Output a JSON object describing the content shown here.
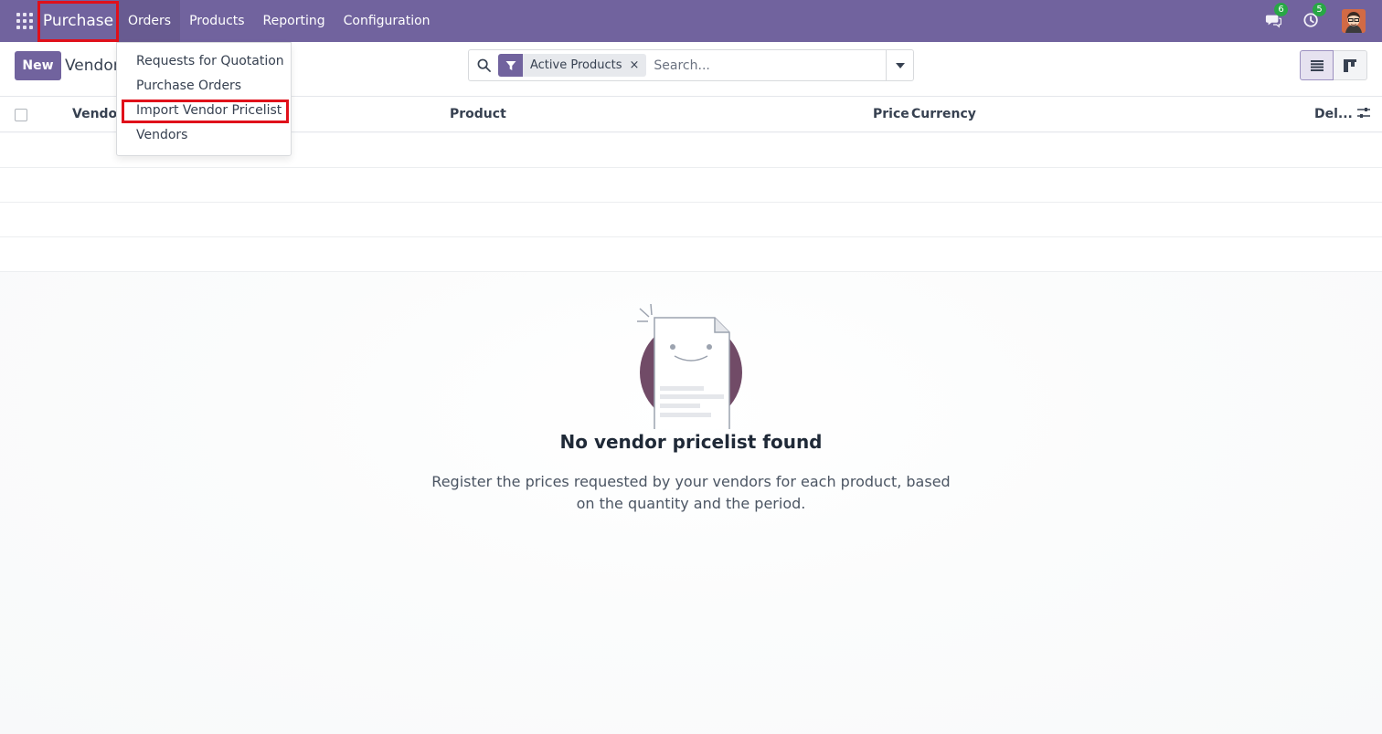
{
  "navbar": {
    "brand": "Purchase",
    "menu": [
      {
        "label": "Orders",
        "active": true
      },
      {
        "label": "Products",
        "active": false
      },
      {
        "label": "Reporting",
        "active": false
      },
      {
        "label": "Configuration",
        "active": false
      }
    ],
    "messages_badge": "6",
    "activities_badge": "5"
  },
  "dropdown": {
    "items": [
      "Requests for Quotation",
      "Purchase Orders",
      "Import Vendor Pricelist",
      "Vendors"
    ],
    "highlighted": "Import Vendor Pricelist"
  },
  "control": {
    "new_label": "New",
    "page_title": "Vendor Pricelists",
    "facet_label": "Active Products",
    "facet_remove": "×",
    "search_placeholder": "Search..."
  },
  "list": {
    "columns": [
      "Vendor",
      "Product",
      "Price",
      "Currency",
      "Del..."
    ]
  },
  "empty": {
    "title": "No vendor pricelist found",
    "description": "Register the prices requested by your vendors for each product, based on the quantity and the period."
  },
  "colors": {
    "navbar": "#71639e",
    "highlight_border": "#e0101a",
    "badge": "#28a745"
  }
}
